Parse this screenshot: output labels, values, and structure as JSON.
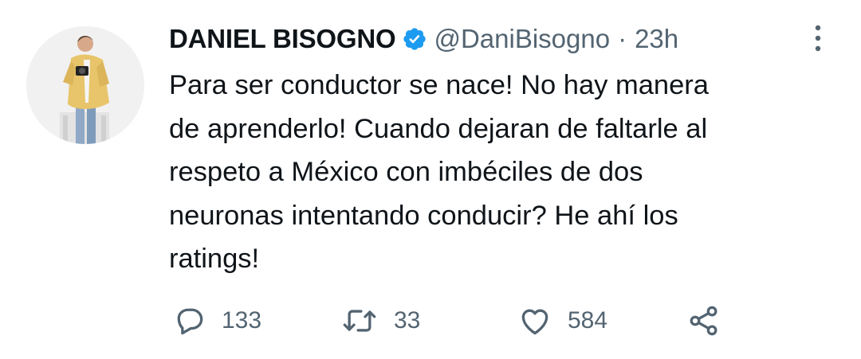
{
  "tweet": {
    "display_name": "DANIEL BISOGNO",
    "handle": "@DaniBisogno",
    "separator": "·",
    "time": "23h",
    "text": "Para ser conductor se nace! No hay manera\nde aprenderlo! Cuando dejaran de faltarle al\nrespeto a México con imbéciles de dos\nneuronas intentando conducir? He ahí los\nratings!",
    "verified": true
  },
  "actions": {
    "reply_count": "133",
    "retweet_count": "33",
    "like_count": "584"
  },
  "colors": {
    "primary_text": "#0f1419",
    "secondary_text": "#536471",
    "verified_blue": "#1d9bf0",
    "background": "#ffffff"
  },
  "icons": [
    "verified-badge-icon",
    "more-icon",
    "reply-icon",
    "retweet-icon",
    "like-icon",
    "share-icon"
  ]
}
